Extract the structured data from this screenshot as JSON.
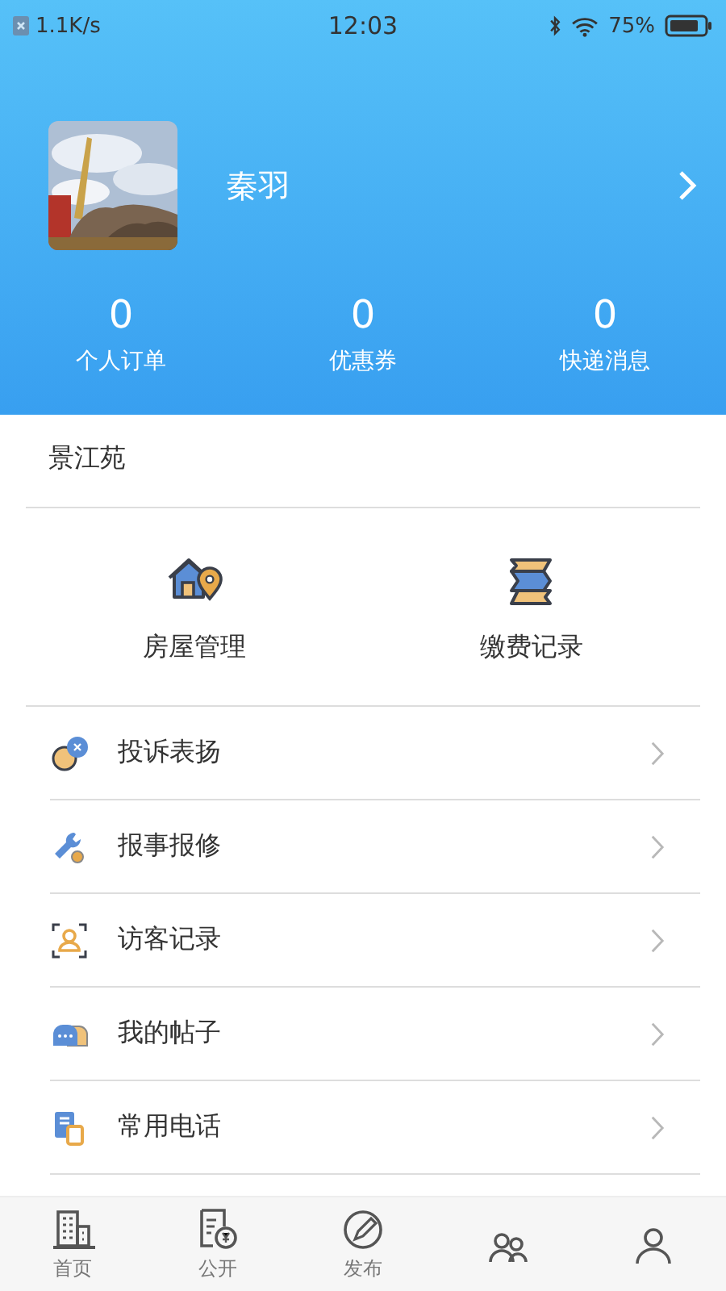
{
  "status_bar": {
    "speed": "1.1K/s",
    "time": "12:03",
    "battery": "75%"
  },
  "profile": {
    "name": "秦羽"
  },
  "stats": [
    {
      "value": "0",
      "label": "个人订单"
    },
    {
      "value": "0",
      "label": "优惠券"
    },
    {
      "value": "0",
      "label": "快递消息"
    }
  ],
  "community": {
    "name": "景江苑"
  },
  "shortcuts": [
    {
      "kind": "house",
      "label": "房屋管理"
    },
    {
      "kind": "bill",
      "label": "缴费记录"
    }
  ],
  "menu": [
    {
      "kind": "complaint",
      "label": "投诉表扬"
    },
    {
      "kind": "repair",
      "label": "报事报修"
    },
    {
      "kind": "visitor",
      "label": "访客记录"
    },
    {
      "kind": "posts",
      "label": "我的帖子"
    },
    {
      "kind": "phone",
      "label": "常用电话"
    }
  ],
  "tabs": [
    {
      "kind": "home",
      "label": "首页"
    },
    {
      "kind": "notice",
      "label": "公开"
    },
    {
      "kind": "post",
      "label": "发布"
    },
    {
      "kind": "group"
    },
    {
      "kind": "person"
    }
  ]
}
